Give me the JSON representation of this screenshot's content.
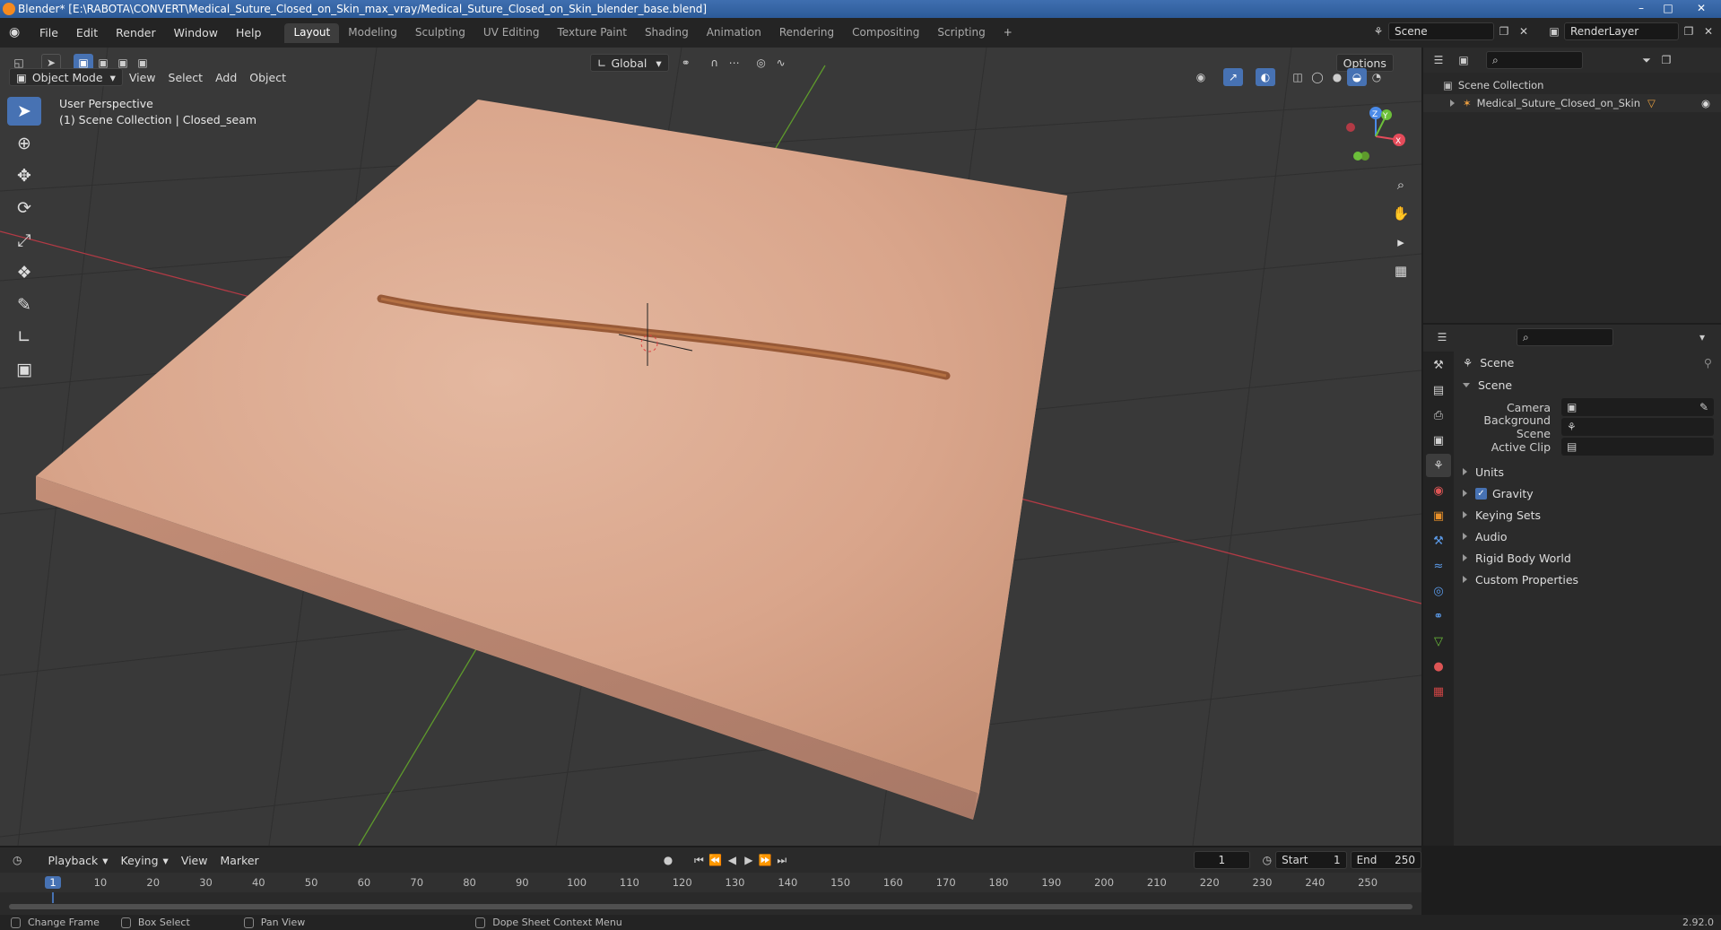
{
  "title": "Blender* [E:\\RABOTA\\CONVERT\\Medical_Suture_Closed_on_Skin_max_vray/Medical_Suture_Closed_on_Skin_blender_base.blend]",
  "menu": [
    "File",
    "Edit",
    "Render",
    "Window",
    "Help"
  ],
  "workspaces": [
    "Layout",
    "Modeling",
    "Sculpting",
    "UV Editing",
    "Texture Paint",
    "Shading",
    "Animation",
    "Rendering",
    "Compositing",
    "Scripting"
  ],
  "active_workspace": "Layout",
  "scene_name": "Scene",
  "render_layer": "RenderLayer",
  "viewport": {
    "mode": "Object Mode",
    "header_menu": [
      "View",
      "Select",
      "Add",
      "Object"
    ],
    "transform_orientation": "Global",
    "options_label": "Options",
    "perspective_label": "User Perspective",
    "collection_label": "(1) Scene Collection | Closed_seam",
    "gizmo_axes": {
      "x": "X",
      "y": "Y",
      "z": "Z"
    }
  },
  "outliner": {
    "root": "Scene Collection",
    "items": [
      {
        "name": "Medical_Suture_Closed_on_Skin"
      }
    ]
  },
  "properties": {
    "header_title": "Scene",
    "panel_title": "Scene",
    "fields": [
      {
        "label": "Camera",
        "value": ""
      },
      {
        "label": "Background Scene",
        "value": ""
      },
      {
        "label": "Active Clip",
        "value": ""
      }
    ],
    "sections": [
      "Units",
      "Gravity",
      "Keying Sets",
      "Audio",
      "Rigid Body World",
      "Custom Properties"
    ],
    "gravity_checked": true
  },
  "timeline": {
    "menu": [
      "Playback",
      "Keying",
      "View",
      "Marker"
    ],
    "current_frame": "1",
    "start_label": "Start",
    "start": "1",
    "end_label": "End",
    "end": "250",
    "ruler": [
      "1",
      "10",
      "20",
      "30",
      "40",
      "50",
      "60",
      "70",
      "80",
      "90",
      "100",
      "110",
      "120",
      "130",
      "140",
      "150",
      "160",
      "170",
      "180",
      "190",
      "200",
      "210",
      "220",
      "230",
      "240",
      "250"
    ]
  },
  "statusbar": {
    "items": [
      "Change Frame",
      "Box Select",
      "Pan View",
      "Dope Sheet Context Menu"
    ],
    "version": "2.92.0"
  },
  "colors": {
    "accent": "#4772b3",
    "x_axis": "#e54b5a",
    "y_axis": "#6cbf3a",
    "z_axis": "#4a8ae8",
    "skin": "#d7a38a"
  }
}
